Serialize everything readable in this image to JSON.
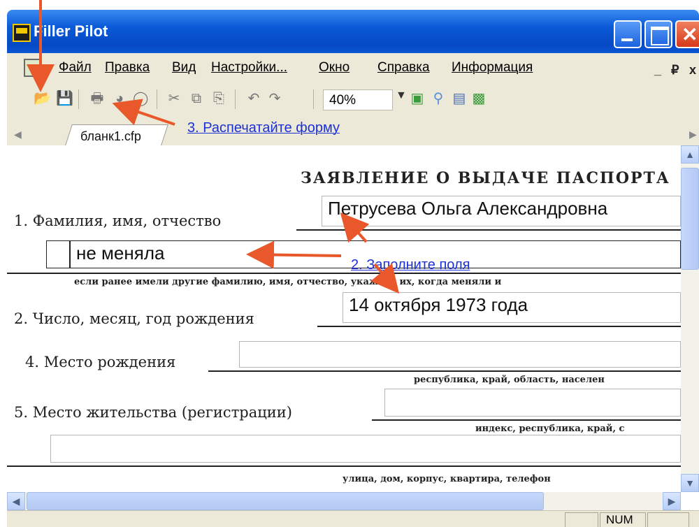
{
  "window": {
    "title": "Filler Pilot"
  },
  "menu": {
    "items": [
      "Файл",
      "Правка",
      "Вид",
      "Настройки...",
      "Окно",
      "Справка",
      "Информация"
    ],
    "mdi_min": "_",
    "mdi_restore": "₽",
    "mdi_close": "x"
  },
  "toolbar": {
    "zoom_value": "40%"
  },
  "tabs": {
    "active": "бланк1.cfp"
  },
  "annotations": {
    "step2": "2. Заполните поля",
    "step3": "3. Распечатайте форму"
  },
  "form": {
    "title": "ЗАЯВЛЕНИЕ О ВЫДАЧЕ ПАСПОРТА",
    "label1": "1. Фамилия, имя, отчество",
    "value_fio": "Петрусева  Ольга  Александровна",
    "value_prev_name": "не меняла",
    "hint_prev_name": "если ранее имели другие фамилию, имя, отчество, укажите их, когда меняли и",
    "label2": "2. Число, месяц, год рождения",
    "value_birth": "14 октября 1973 года",
    "label4": "4. Место рождения",
    "hint_birthplace": "республика, край, область, населен",
    "label5": "5. Место жительства (регистрации)",
    "hint_address": "индекс, республика, край, с",
    "hint_street": "улица, дом, корпус, квартира, телефон"
  },
  "status": {
    "num": "NUM"
  },
  "colors": {
    "titlebar": "#0a5ad8",
    "annotation_text": "#1c30d8",
    "arrow": "#e8582a"
  }
}
